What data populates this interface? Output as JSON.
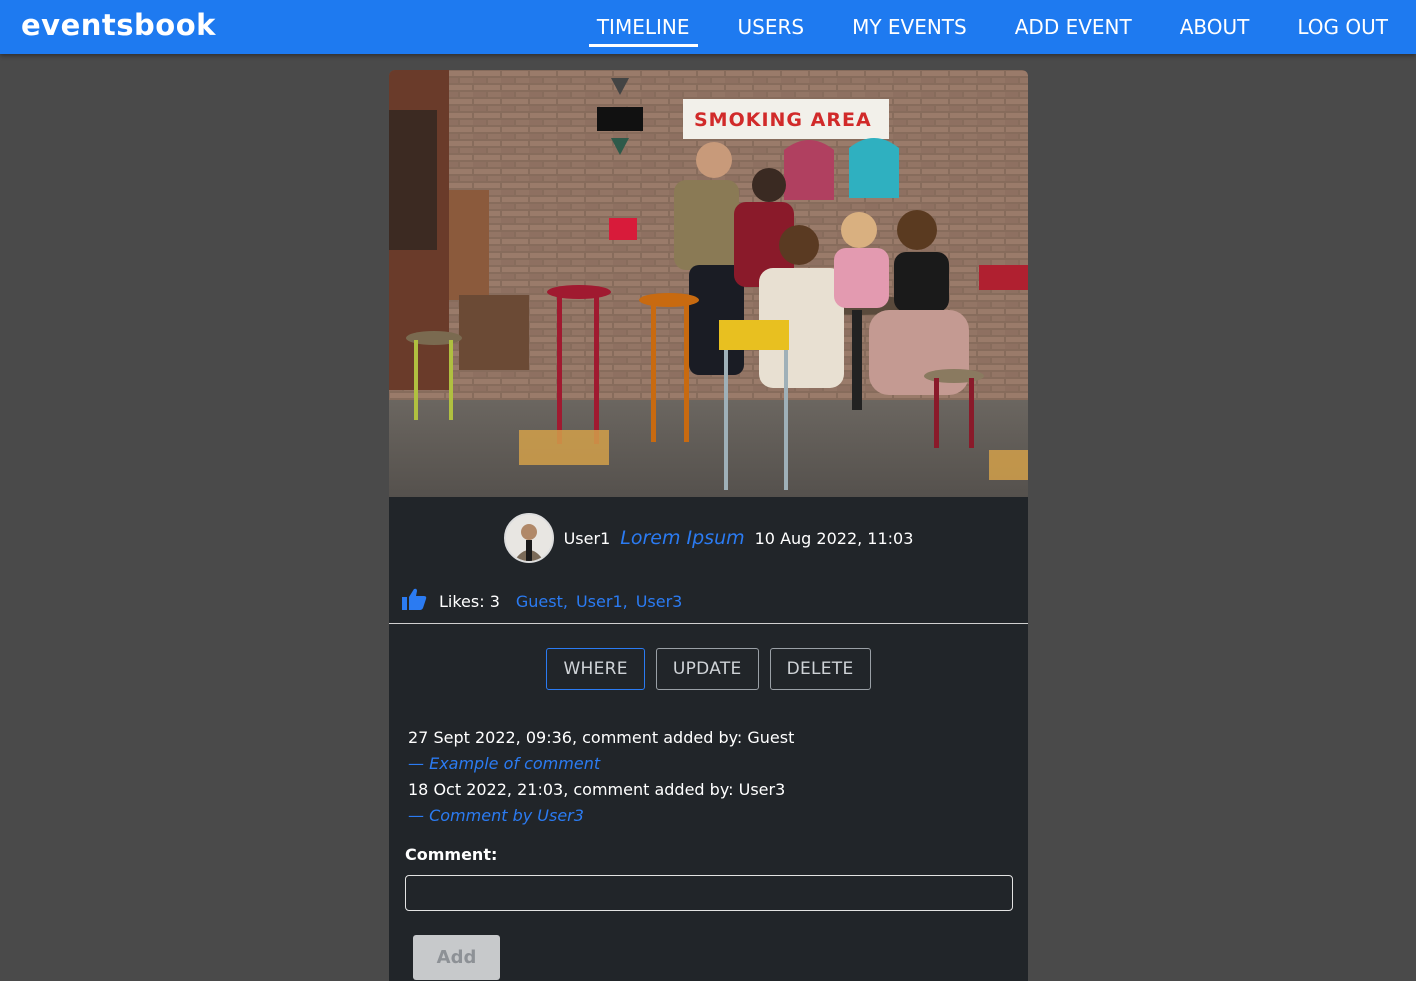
{
  "brand": "eventsbook",
  "nav": [
    {
      "label": "TIMELINE",
      "active": true
    },
    {
      "label": "USERS"
    },
    {
      "label": "MY EVENTS"
    },
    {
      "label": "ADD EVENT"
    },
    {
      "label": "ABOUT"
    },
    {
      "label": "LOG OUT"
    }
  ],
  "event": {
    "photo_sign_text": "SMOKING AREA",
    "author": "User1",
    "title": "Lorem Ipsum",
    "date": "10 Aug 2022, 11:03",
    "likes_label": "Likes: 3",
    "likers": [
      "Guest,",
      "User1,",
      "User3"
    ],
    "actions": {
      "where": "WHERE",
      "update": "UPDATE",
      "delete": "DELETE"
    },
    "comments": [
      {
        "header": "27 Sept 2022, 09:36, comment added by: Guest",
        "text": "— Example of comment"
      },
      {
        "header": "18 Oct 2022, 21:03, comment added by: User3",
        "text": "— Comment by User3"
      }
    ],
    "comment_form": {
      "label": "Comment:",
      "value": "",
      "submit_label": "Add"
    }
  },
  "colors": {
    "navbar": "#1e7af0",
    "card": "#212529",
    "page_bg": "#4a4a4a",
    "link": "#2b7bf2"
  },
  "icons": {
    "like": "thumbs-up-icon"
  }
}
